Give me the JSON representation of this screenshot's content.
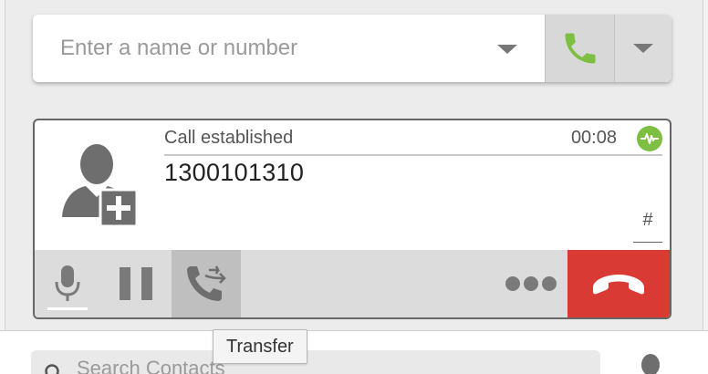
{
  "dial": {
    "placeholder": "Enter a name or number",
    "call_icon": "phone-icon",
    "more_icon": "chevron-down-icon"
  },
  "call": {
    "status": "Call established",
    "timer": "00:08",
    "number": "1300101310",
    "keypad_label": "#",
    "avatar_icon": "add-contact-icon",
    "activity_icon": "waveform-icon"
  },
  "controls": {
    "mute_icon": "microphone-icon",
    "hold_icon": "pause-icon",
    "transfer_icon": "transfer-icon",
    "more_icon": "more-dots-icon",
    "hangup_icon": "hangup-icon"
  },
  "tooltip": {
    "text": "Transfer"
  },
  "contacts": {
    "search_placeholder": "Search Contacts"
  },
  "colors": {
    "accent_green": "#7cbf43",
    "hangup_red": "#d93a34",
    "active_button": "#bfbfbf"
  }
}
